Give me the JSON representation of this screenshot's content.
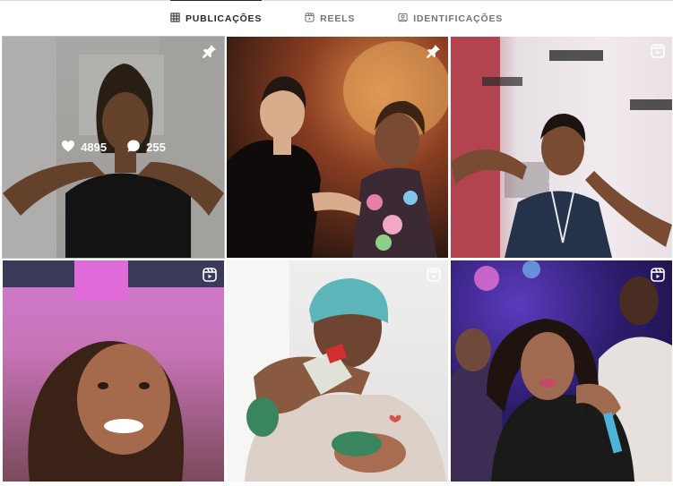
{
  "tabs": [
    {
      "label": "PUBLICAÇÕES",
      "icon": "grid-icon",
      "active": true
    },
    {
      "label": "REELS",
      "icon": "reels-icon",
      "active": false
    },
    {
      "label": "IDENTIFICAÇÕES",
      "icon": "tagged-icon",
      "active": false
    }
  ],
  "posts": [
    {
      "type": "pinned",
      "likes": "4895",
      "comments": "255",
      "hovered": true
    },
    {
      "type": "pinned"
    },
    {
      "type": "reel"
    },
    {
      "type": "reel"
    },
    {
      "type": "reel"
    },
    {
      "type": "reel"
    }
  ],
  "colors": {
    "active_tab": "#262626",
    "inactive_tab": "#737373",
    "divider": "#dbdbdb"
  }
}
